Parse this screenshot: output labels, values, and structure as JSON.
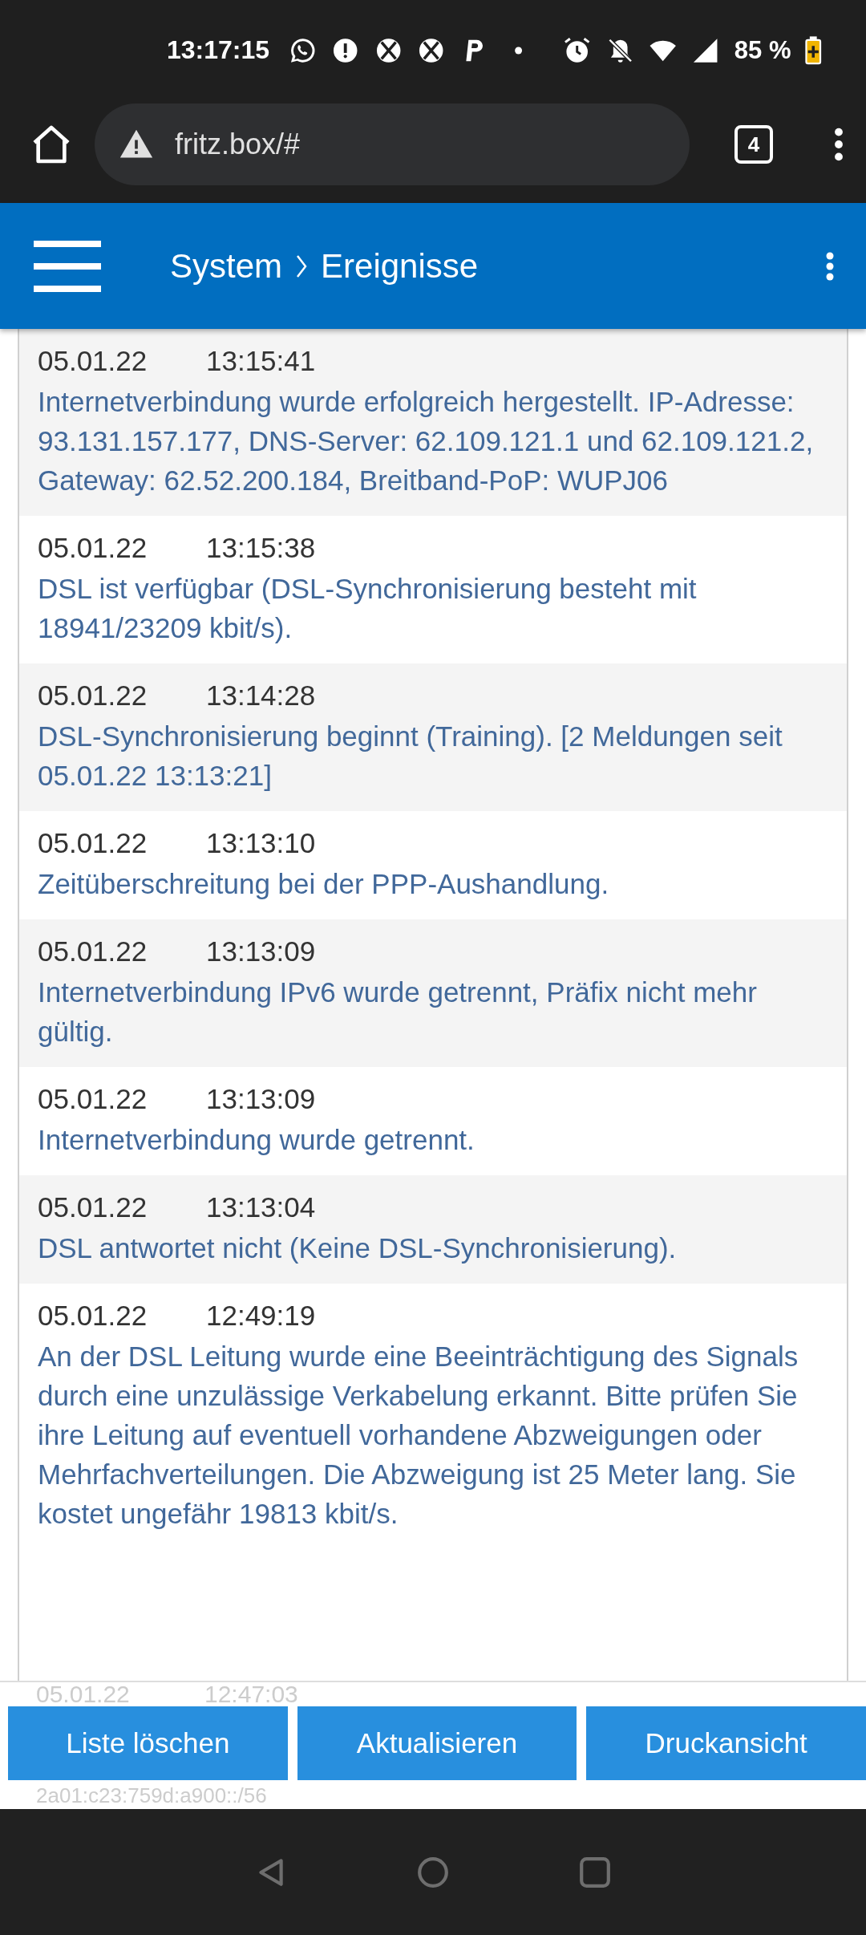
{
  "status_bar": {
    "time": "13:17:15",
    "battery": "85 %"
  },
  "browser": {
    "url": "fritz.box/#",
    "tab_count": "4"
  },
  "header": {
    "breadcrumb": [
      "System",
      "Ereignisse"
    ]
  },
  "events": [
    {
      "date": "05.01.22",
      "time": "13:15:41",
      "message": "Internetverbindung wurde erfolgreich hergestellt. IP-Adresse: 93.131.157.177, DNS-Server: 62.109.121.1 und 62.109.121.2, Gateway: 62.52.200.184, Breitband-PoP: WUPJ06"
    },
    {
      "date": "05.01.22",
      "time": "13:15:38",
      "message": "DSL ist verfügbar (DSL-Synchronisierung besteht mit 18941/23209 kbit/s)."
    },
    {
      "date": "05.01.22",
      "time": "13:14:28",
      "message": "DSL-Synchronisierung beginnt (Training). [2 Meldungen seit 05.01.22 13:13:21]"
    },
    {
      "date": "05.01.22",
      "time": "13:13:10",
      "message": "Zeitüberschreitung bei der PPP-Aushandlung."
    },
    {
      "date": "05.01.22",
      "time": "13:13:09",
      "message": "Internetverbindung IPv6 wurde getrennt, Präfix nicht mehr gültig."
    },
    {
      "date": "05.01.22",
      "time": "13:13:09",
      "message": "Internetverbindung wurde getrennt."
    },
    {
      "date": "05.01.22",
      "time": "13:13:04",
      "message": "DSL antwortet nicht (Keine DSL-Synchronisierung)."
    },
    {
      "date": "05.01.22",
      "time": "12:49:19",
      "message": "An der DSL Leitung wurde eine Beeinträchtigung des Signals durch eine unzulässige Verkabelung erkannt. Bitte prüfen Sie ihre Leitung auf eventuell vorhandene Abzweigungen oder Mehrfachverteilungen. Die Abzweigung ist 25 Meter lang. Sie kostet ungefähr 19813 kbit/s."
    }
  ],
  "partial_event": {
    "date": "05.01.22",
    "time": "12:47:03",
    "message_tail": "2a01:c23:759d:a900::/56"
  },
  "buttons": [
    "Liste löschen",
    "Aktualisieren",
    "Druckansicht"
  ]
}
